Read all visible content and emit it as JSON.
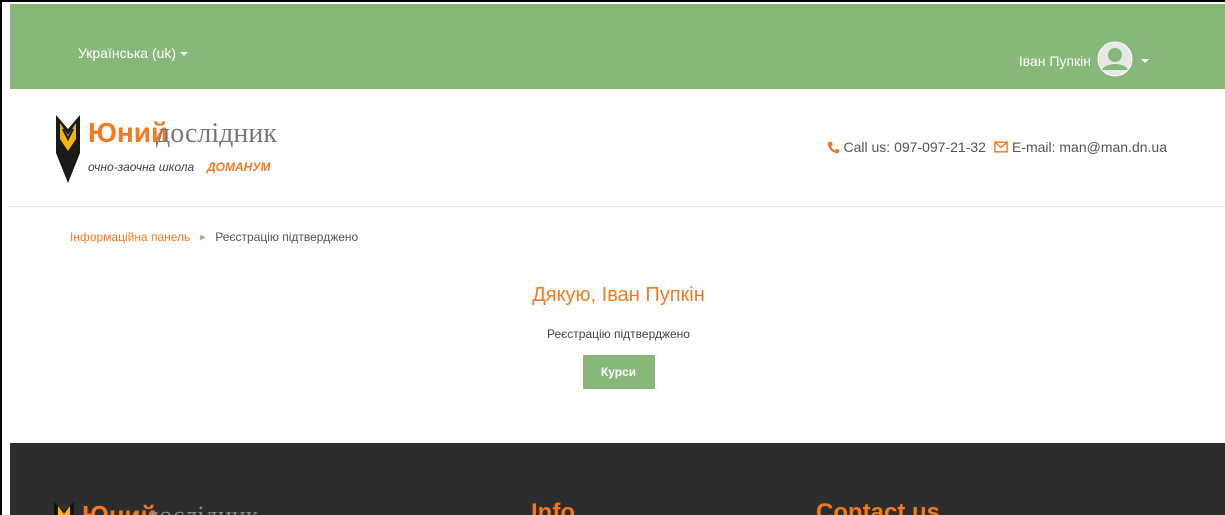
{
  "topbar": {
    "language": "Українська (uk)",
    "user_name": "Іван Пупкін"
  },
  "header": {
    "logo_line1_bold": "Юний",
    "logo_line1_rest": "дослідник",
    "logo_line2_left": "очно-заочна школа",
    "logo_line2_right": "ДОМАНУМ",
    "call": "Call us: 097-097-21-32",
    "email": "E-mail: man@man.dn.ua"
  },
  "breadcrumb": {
    "home": "Інформаційна панель",
    "current": "Реєстрацію підтверджено"
  },
  "main": {
    "title": "Дякую, Іван Пупкін",
    "message": "Реєстрацію підтверджено",
    "button": "Курси"
  },
  "footer": {
    "logo_bold": "Юний",
    "logo_rest": "дослідник",
    "col1_title": "Info",
    "col2_title": "Contact us"
  },
  "colors": {
    "accent_green": "#87b87a",
    "accent_orange": "#f47a20",
    "footer_bg": "#2d2d2d"
  },
  "icons": {
    "phone": "phone-icon",
    "email": "envelope-icon",
    "user": "user-avatar-icon"
  }
}
